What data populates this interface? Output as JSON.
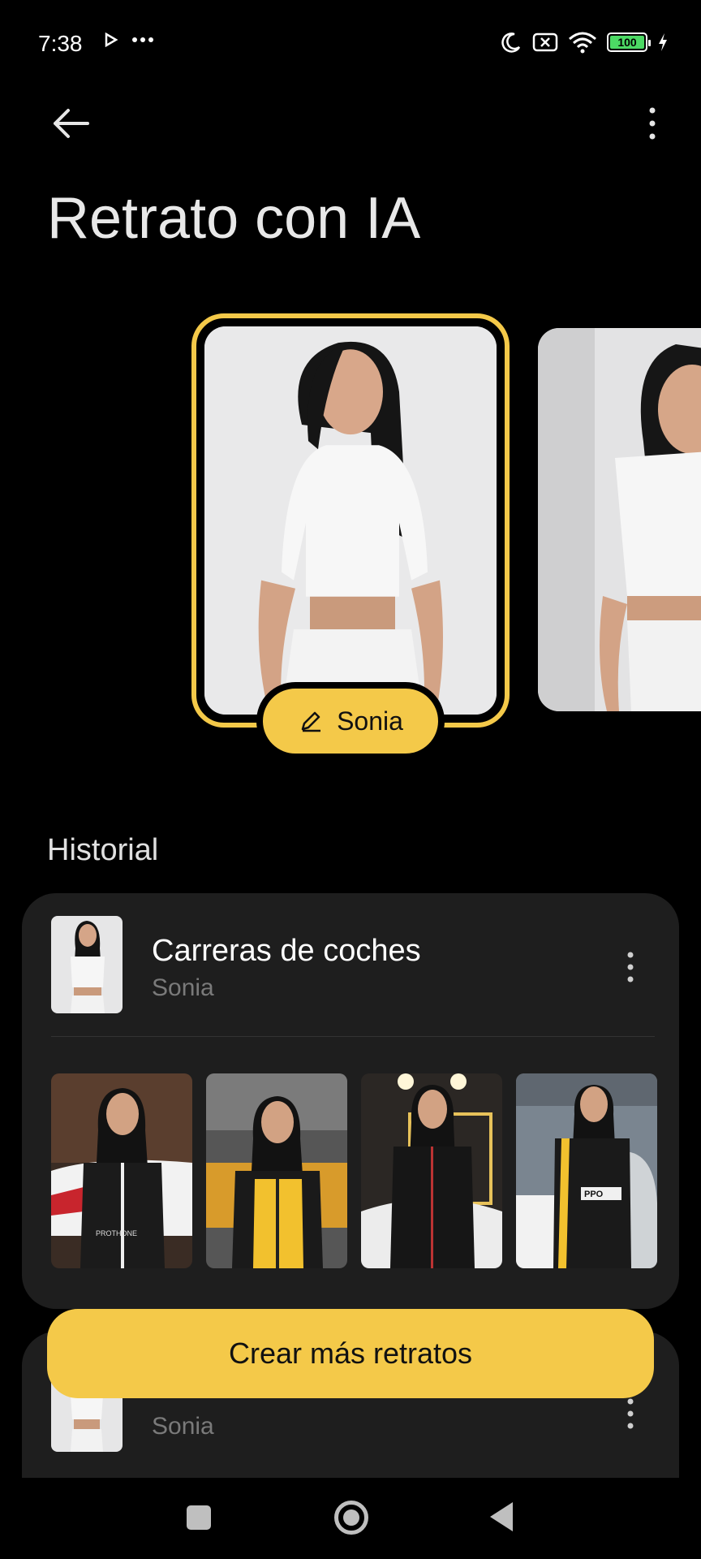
{
  "status_bar": {
    "time": "7:38",
    "battery": "100",
    "icons": [
      "play-icon",
      "more-horiz-icon",
      "moon-icon",
      "sim-off-icon",
      "wifi-icon",
      "battery-icon",
      "charging-icon"
    ]
  },
  "header": {
    "back_icon": "arrow-left-icon",
    "menu_icon": "more-vertical-icon",
    "title": "Retrato con IA"
  },
  "carousel": {
    "selected_name": "Sonia",
    "edit_icon": "pencil-icon"
  },
  "history": {
    "section_title": "Historial",
    "items": [
      {
        "title": "Carreras de coches",
        "subtitle": "Sonia"
      },
      {
        "title": "",
        "subtitle": "Sonia"
      }
    ]
  },
  "cta": {
    "label": "Crear más retratos"
  },
  "colors": {
    "accent": "#f4c949",
    "card": "#1e1e1e",
    "background": "#000000"
  }
}
